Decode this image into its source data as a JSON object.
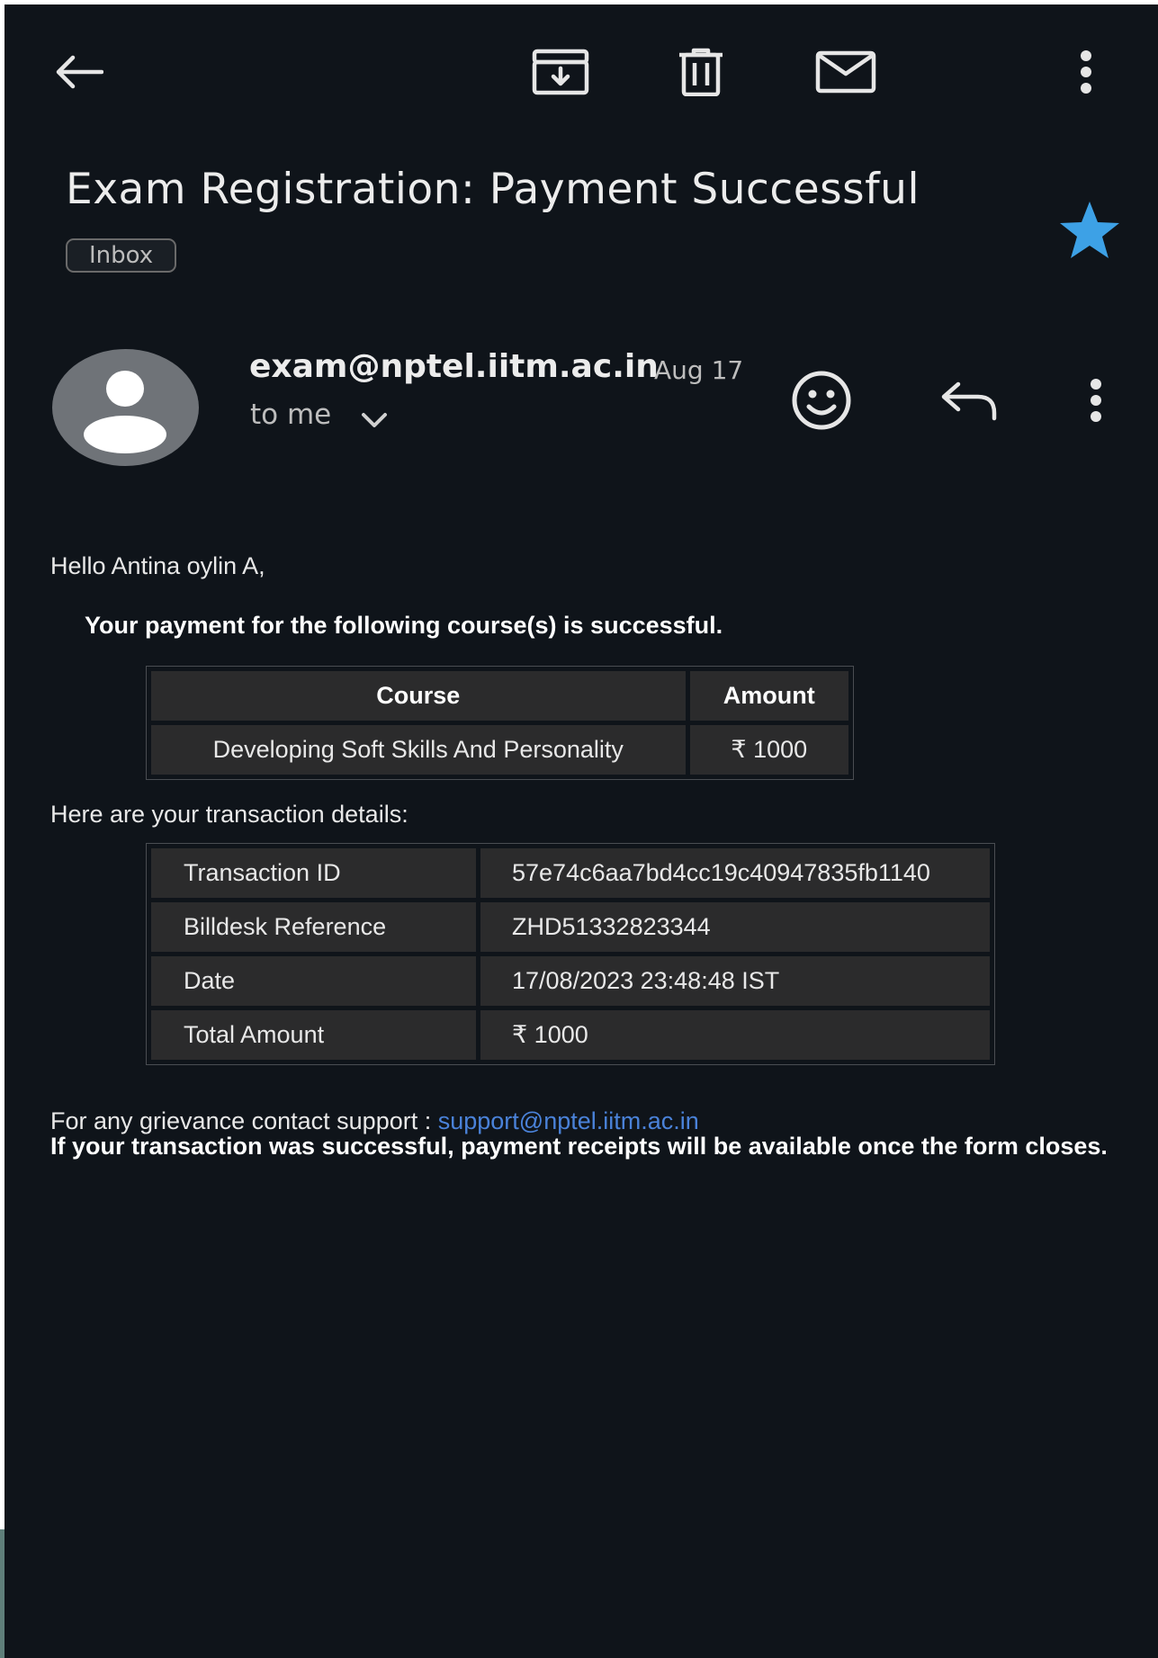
{
  "toolbar": {
    "back_icon": "arrow-left-icon",
    "archive_icon": "archive-icon",
    "delete_icon": "trash-icon",
    "mark_unread_icon": "envelope-icon",
    "more_icon": "more-vert-icon"
  },
  "email": {
    "subject": "Exam Registration: Payment Successful",
    "label": "Inbox",
    "starred": true,
    "star_color": "#3da1e6",
    "sender": "exam@nptel.iitm.ac.in",
    "date": "Aug 17",
    "recipient": "to me"
  },
  "body": {
    "greeting": "Hello Antina oylin A,",
    "lead": "Your payment for the following course(s) is successful.",
    "course_table": {
      "headers": [
        "Course",
        "Amount"
      ],
      "rows": [
        [
          "Developing Soft Skills And Personality",
          "₹ 1000"
        ]
      ]
    },
    "details_intro": "Here are your transaction details:",
    "transaction_table": {
      "rows": [
        [
          "Transaction ID",
          "57e74c6aa7bd4cc19c40947835fb1140"
        ],
        [
          "Billdesk Reference",
          "ZHD51332823344"
        ],
        [
          "Date",
          "17/08/2023 23:48:48 IST"
        ],
        [
          "Total Amount",
          "₹ 1000"
        ]
      ]
    },
    "support_prefix": "For any grievance contact support : ",
    "support_email": "support@nptel.iitm.ac.in",
    "receipt_note": "If your transaction was successful, payment receipts will be available once the form closes."
  },
  "colors": {
    "background": "#0f141a",
    "link": "#4a82d9",
    "table_cell": "#2b2b2c"
  }
}
